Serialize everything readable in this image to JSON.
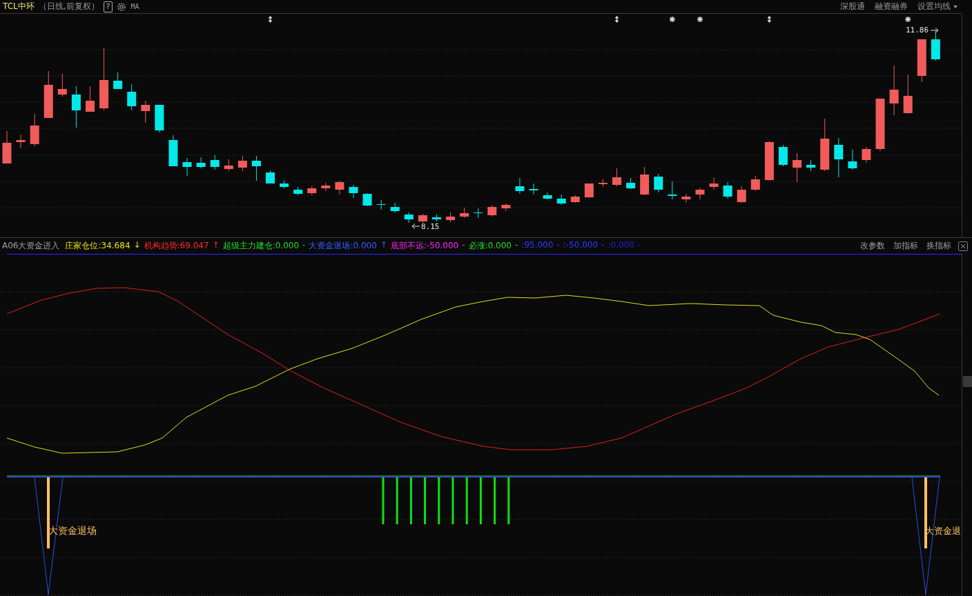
{
  "title_bar": {
    "symbol": "TCL中环",
    "period": "（日线,前复权）",
    "help_button": "?",
    "ma_label": "MA",
    "links": [
      {
        "label": "深股通",
        "dropdown": false
      },
      {
        "label": "融资融券",
        "dropdown": false
      },
      {
        "label": "设置均线",
        "dropdown": true
      }
    ]
  },
  "price_chart": {
    "high_label": "11.86",
    "low_label": "8.15"
  },
  "indicator": {
    "name": "A06大资金进入",
    "values": [
      {
        "text": "庄家仓位:34.684",
        "marker": "↓",
        "color": "#e8e800"
      },
      {
        "text": "机构趋势:69.047",
        "marker": "↑",
        "color": "#ff2a2a"
      },
      {
        "text": "超级主力建仓:0.000",
        "marker": "-",
        "color": "#22dd22"
      },
      {
        "text": "大资金退场:0.000",
        "marker": "↑",
        "color": "#3a5cff"
      },
      {
        "text": "底部不远:-50.000",
        "marker": "-",
        "color": "#ff2aff"
      },
      {
        "text": "必涨:0.000",
        "marker": "-",
        "color": "#22dd22"
      },
      {
        "text": ":95.000",
        "marker": "-",
        "color": "#2a3cff"
      },
      {
        "text": ":-50.000",
        "marker": "-",
        "color": "#2a3cff"
      },
      {
        "text": ":0.000",
        "marker": "-",
        "color": "#2222c8"
      }
    ],
    "buttons": [
      "改参数",
      "加指标",
      "换指标"
    ],
    "signal_labels": [
      "大资金退场",
      "大资金退"
    ]
  }
}
